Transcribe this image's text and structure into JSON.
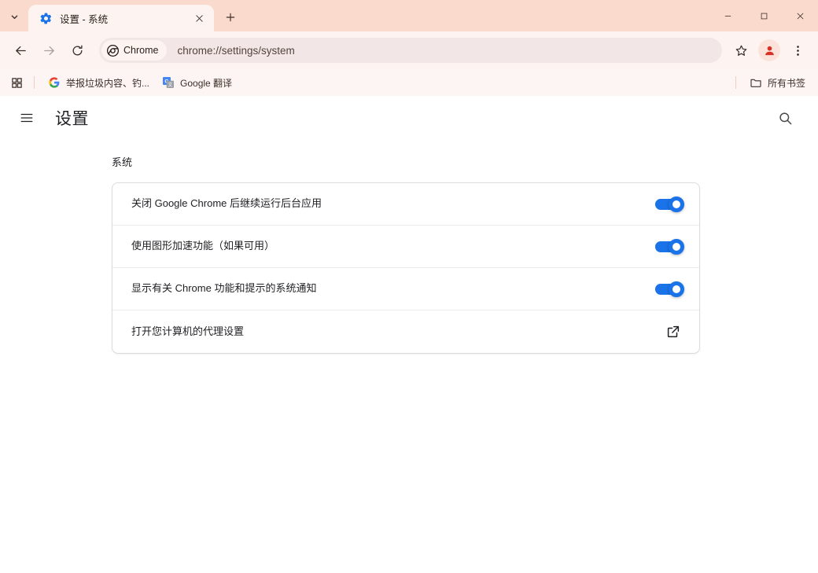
{
  "window": {
    "minimize_label": "最小化",
    "maximize_label": "最大化",
    "close_label": "关闭"
  },
  "tabstrip": {
    "tab_search_label": "搜索标签页",
    "new_tab_label": "新建标签页",
    "tabs": [
      {
        "title": "设置 - 系统",
        "favicon": "gear-icon",
        "close_label": "关闭标签页",
        "active": true
      }
    ]
  },
  "toolbar": {
    "back_label": "返回",
    "forward_label": "前进",
    "reload_label": "重新加载此页",
    "chrome_chip_label": "Chrome",
    "url_scheme": "chrome://",
    "url_path": "settings/system",
    "url_full": "chrome://settings/system",
    "bookmark_label": "将此标签页加入书签",
    "profile_label": "个人资料",
    "menu_label": "自定义及控制 Google Chrome"
  },
  "bookmarks_bar": {
    "apps_label": "应用",
    "items": [
      {
        "label": "举报垃圾内容、钓...",
        "icon": "google-icon"
      },
      {
        "label": "Google 翻译",
        "icon": "google-translate-icon"
      }
    ],
    "all_bookmarks_label": "所有书签",
    "all_bookmarks_icon": "folder-icon"
  },
  "settings": {
    "menu_button_label": "主菜单",
    "page_title": "设置",
    "search_label": "搜索设置",
    "section_title": "系统",
    "rows": [
      {
        "label": "关闭 Google Chrome 后继续运行后台应用",
        "control": "toggle",
        "checked": true
      },
      {
        "label": "使用图形加速功能（如果可用）",
        "control": "toggle",
        "checked": true
      },
      {
        "label": "显示有关 Chrome 功能和提示的系统通知",
        "control": "toggle",
        "checked": true
      },
      {
        "label": "打开您计算机的代理设置",
        "control": "external-link",
        "checked": null
      }
    ]
  },
  "colors": {
    "titlebar_bg": "#fbdace",
    "toolbar_bg": "#fdf3f0",
    "omnibox_bg": "#f2e7e6",
    "bookmarks_bg": "#fdf5f3",
    "toggle_on": "#1a73e8",
    "page_bg": "#ffffff",
    "card_border": "#dadce0",
    "text_primary": "#202124"
  }
}
